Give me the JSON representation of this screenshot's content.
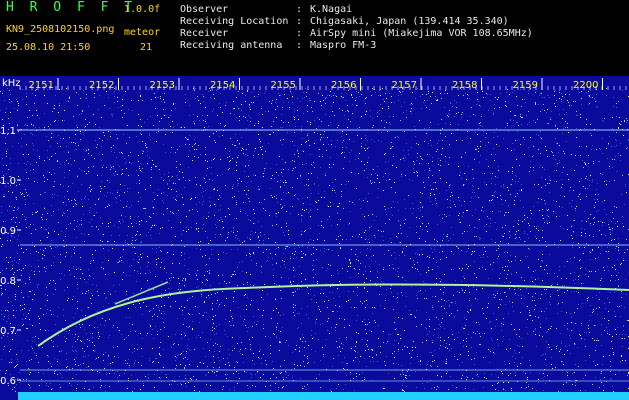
{
  "header": {
    "app_title": "H R O F F T",
    "version": "1.0.0f",
    "filename": "KN9_2508102150.png",
    "meteor_label": "meteor",
    "datetime": "25.08.10 21:50",
    "meteor_count": "21"
  },
  "info": [
    {
      "label": "Observer",
      "sep": ":",
      "value": "K.Nagai"
    },
    {
      "label": "Receiving Location",
      "sep": ":",
      "value": "Chigasaki, Japan (139.414 35.340)"
    },
    {
      "label": "Receiver",
      "sep": ":",
      "value": "AirSpy mini (Miakejima VOR 108.65MHz)"
    },
    {
      "label": "Receiving antenna",
      "sep": ":",
      "value": "Maspro FM-3"
    }
  ],
  "colors": {
    "background": "#0a0a9c",
    "noise_light": "#78d8ff",
    "noise_mid": "#2a5fe0",
    "trail": "#b8ff9a",
    "tick_label": "#ffff00",
    "freq_label": "#ffffff"
  },
  "plot": {
    "y_unit": "kHz",
    "time_ticks": [
      "2151",
      "2152",
      "2153",
      "2154",
      "2155",
      "2156",
      "2157",
      "2158",
      "2159",
      "2200"
    ],
    "freq_ticks": [
      "1.1",
      "1.0",
      "0.9",
      "0.8",
      "0.7",
      "0.6"
    ]
  }
}
